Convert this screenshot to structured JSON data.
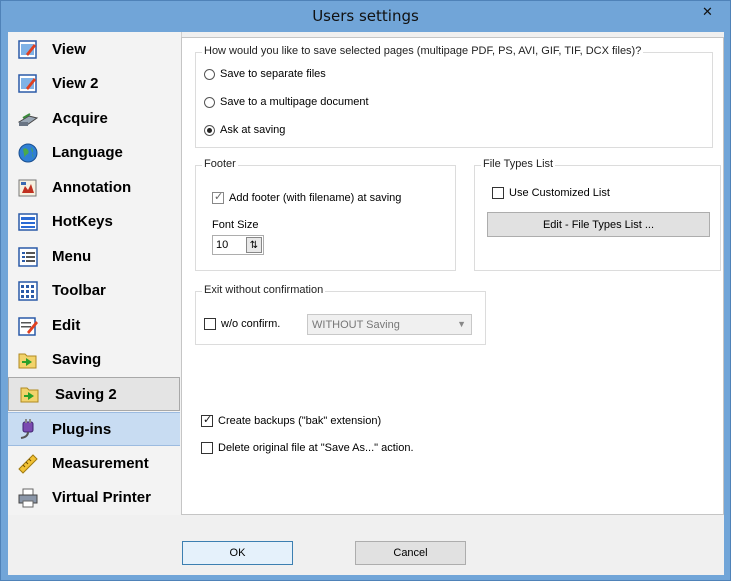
{
  "window": {
    "title": "Users settings",
    "close_glyph": "✕"
  },
  "sidebar": {
    "items": [
      {
        "label": "View",
        "icon": "view-icon"
      },
      {
        "label": "View 2",
        "icon": "view2-icon"
      },
      {
        "label": "Acquire",
        "icon": "scanner-icon"
      },
      {
        "label": "Language",
        "icon": "globe-icon"
      },
      {
        "label": "Annotation",
        "icon": "annotation-icon"
      },
      {
        "label": "HotKeys",
        "icon": "keyboard-icon"
      },
      {
        "label": "Menu",
        "icon": "menu-icon"
      },
      {
        "label": "Toolbar",
        "icon": "toolbar-icon"
      },
      {
        "label": "Edit",
        "icon": "edit-icon"
      },
      {
        "label": "Saving",
        "icon": "folder-save-icon"
      },
      {
        "label": "Saving 2",
        "icon": "folder-save-icon"
      },
      {
        "label": "Plug-ins",
        "icon": "plug-icon"
      },
      {
        "label": "Measurement",
        "icon": "ruler-icon"
      },
      {
        "label": "Virtual Printer",
        "icon": "printer-icon"
      }
    ],
    "hover_index": 10,
    "selected_index": 11
  },
  "save_pages": {
    "question": "How would you like to save selected pages (multipage PDF, PS, AVI, GIF, TIF, DCX files)?",
    "options": [
      {
        "label": "Save to separate files",
        "selected": false
      },
      {
        "label": "Save to a multipage document",
        "selected": false
      },
      {
        "label": "Ask at saving",
        "selected": true
      }
    ]
  },
  "footer": {
    "title": "Footer",
    "add_footer_label": "Add footer (with filename) at saving",
    "add_footer_checked": true,
    "font_size_label": "Font Size",
    "font_size_value": "10"
  },
  "file_types": {
    "title": "File Types List",
    "use_customized_label": "Use Customized List",
    "use_customized_checked": false,
    "edit_button_label": "Edit - File Types List ..."
  },
  "exit_confirm": {
    "title": "Exit without confirmation",
    "checkbox_label": "w/o confirm.",
    "checked": false,
    "select_value": "WITHOUT Saving"
  },
  "options": {
    "create_backups_label": "Create backups (\"bak\" extension)",
    "create_backups_checked": true,
    "delete_original_label": "Delete original file at \"Save As...\" action.",
    "delete_original_checked": false
  },
  "buttons": {
    "ok_label": "OK",
    "cancel_label": "Cancel"
  }
}
